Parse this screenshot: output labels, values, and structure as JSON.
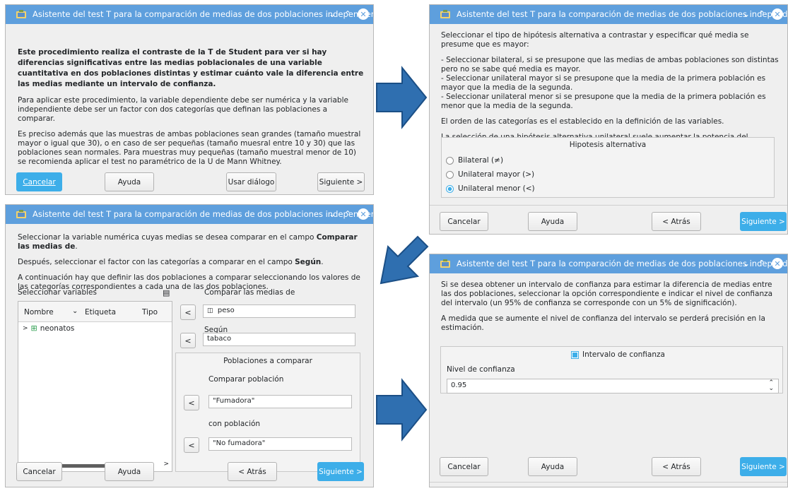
{
  "window_title": "Asistente del test T para la comparación de medias de dos poblaciones independientes",
  "colors": {
    "titlebar": "#5e9fdd",
    "accent": "#3daee9",
    "flow_arrow": "#2f6fb0"
  },
  "icons": [
    "app-icon",
    "minimize-icon",
    "maximize-icon",
    "close-icon",
    "right-arrow-icon",
    "down-left-arrow-icon",
    "variables-list-icon",
    "scrollbar-arrow-icon",
    "spin-icon"
  ],
  "win1": {
    "intro_bold": "Este procedimiento realiza el contraste de la T de Student para ver si hay diferencias significativas entre las medias poblacionales de una variable cuantitativa en dos poblaciones distintas y estimar cuánto vale la diferencia entre las medias mediante un intervalo de confianza.",
    "para2": "Para aplicar este procedimiento, la variable dependiente debe ser numérica y la variable independiente debe ser un factor con dos categorías que definan las poblaciones a comparar.",
    "para3": "Es preciso además que las muestras de ambas poblaciones sean grandes (tamaño muestral mayor o igual que 30), o en caso de ser pequeñas (tamaño muesral entre 10 y 30) que las poblaciones sean normales. Para muestras muy pequeñas (tamaño muestral menor de 10) se recomienda aplicar el test no paramétrico de la U de Mann Whitney.",
    "cancel_label": "Cancelar",
    "help_label": "Ayuda",
    "use_dialog_label": "Usar diálogo",
    "next_label": "Siguiente >"
  },
  "win2": {
    "p1": "Seleccionar el tipo de hipótesis alternativa a contrastar y especificar qué media se presume que es mayor:",
    "p2a": "- Seleccionar bilateral, si se presupone que las medias de ambas poblaciones son distintas pero no se sabe qué media es mayor.",
    "p2b": "- Seleccionar unilateral mayor si se presupone que la media de la primera población es mayor que la media de la segunda.",
    "p2c": "- Seleccionar unilateral menor si se presupone que la media de la primera población es menor que la media de la segunda.",
    "p3": "El orden de las categorías es el establecido en la definición de las variables.",
    "p4": "La selección de una hipótesis alternativa unilateral suele aumentar la potencia del contraste.",
    "group_title": "Hipotesis alternativa",
    "options": [
      "Bilateral (≠)",
      "Unilateral mayor (>)",
      "Unilateral menor (<)"
    ],
    "selected_option": "Unilateral menor (<)",
    "cancel_label": "Cancelar",
    "help_label": "Ayuda",
    "back_label": "< Atrás",
    "next_label": "Siguiente >"
  },
  "win3": {
    "p1_pre": "Seleccionar la variable numérica cuyas medias se desea comparar en el campo ",
    "p1_bold": "Comparar las medias de",
    "p1_post": ".",
    "p2_pre": "Después, seleccionar el factor con las categorías a comparar en el campo ",
    "p2_bold": "Según",
    "p2_post": ".",
    "p3": "A continuación hay que definir las dos poblaciones a comparar seleccionando los valores de las categorías correspondientes a cada una de las dos poblaciones.",
    "select_vars_label": "Seleccionar variables",
    "col_name": "Nombre",
    "col_label": "Etiqueta",
    "col_type": "Tipo",
    "tree_item": "neonatos",
    "compare_means_label": "Comparar las medias de",
    "compare_means_value": "peso",
    "according_label": "Según",
    "according_value": "tabaco",
    "populations_title": "Poblaciones a comparar",
    "compare_pop_label": "Comparar población",
    "compare_pop_value": "\"Fumadora\"",
    "with_pop_label": "con población",
    "with_pop_value": "\"No fumadora\"",
    "cancel_label": "Cancelar",
    "help_label": "Ayuda",
    "back_label": "< Atrás",
    "next_label": "Siguiente >"
  },
  "win4": {
    "p1": "Si se desea obtener un intervalo de confianza para estimar la diferencia de medias entre las dos poblaciones, seleccionar la opción correspondiente e indicar el nivel de confianza del intervalo (un 95% de confianza se corresponde con un 5% de significación).",
    "p2": "A medida que se aumente el nivel de confianza del intervalo se perderá precisión en la estimación.",
    "checkbox_label": "Intervalo de confianza",
    "checkbox_checked": true,
    "level_label": "Nivel de confianza",
    "level_value": "0.95",
    "cancel_label": "Cancelar",
    "help_label": "Ayuda",
    "back_label": "< Atrás",
    "next_label": "Siguiente >"
  }
}
